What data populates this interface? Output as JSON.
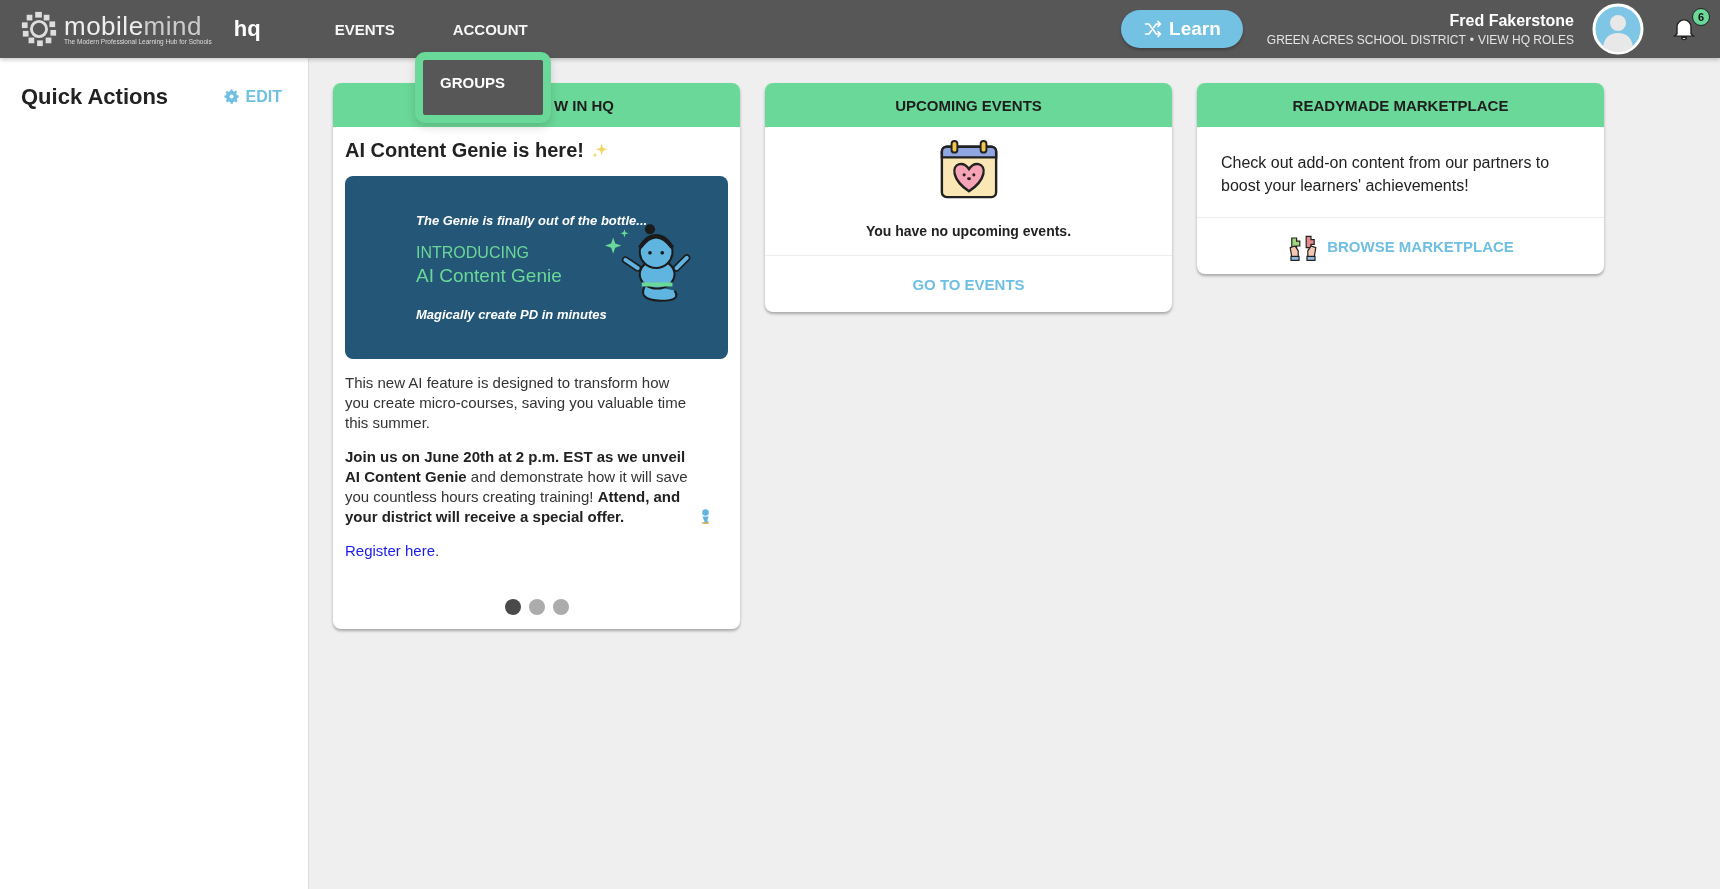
{
  "header": {
    "logo": {
      "first": "mobile",
      "second": "mind",
      "tagline": "The Modern Professional Learning Hub for Schools"
    },
    "product": "hq",
    "nav": [
      {
        "label": "EVENTS"
      },
      {
        "label": "ACCOUNT"
      }
    ],
    "learn_button": "Learn",
    "user": {
      "name": "Fred Fakerstone",
      "district": "GREEN ACRES SCHOOL DISTRICT",
      "separator": "•",
      "roles_link": "VIEW HQ ROLES"
    },
    "notifications": "6"
  },
  "dropdown": {
    "items": [
      "GROUPS"
    ]
  },
  "sidebar": {
    "title": "Quick Actions",
    "edit": "EDIT"
  },
  "cards": [
    {
      "kind": "news",
      "header": "W IN HQ",
      "title": "AI Content Genie is here!",
      "banner": {
        "tagline": "The Genie is finally out of the bottle...",
        "kicker": "INTRODUCING",
        "title": "AI Content Genie",
        "subtitle": "Magically create PD in minutes"
      },
      "paragraphs": [
        "This new AI feature is designed to transform how you create micro-courses, saving you valuable time this summer.",
        "**Join us on June 20th at 2 p.m. EST as we unveil AI Content Genie** and demonstrate how it will save you countless hours creating training! **Attend, and your district will receive a special offer.**"
      ],
      "register": {
        "link": "Register here",
        "suffix": "."
      },
      "dots": [
        {
          "selected": true
        },
        {
          "selected": false
        },
        {
          "selected": false
        }
      ]
    },
    {
      "kind": "events",
      "header": "UPCOMING EVENTS",
      "message": "You have no upcoming events.",
      "action": "GO TO EVENTS"
    },
    {
      "kind": "marketplace",
      "header": "READYMADE MARKETPLACE",
      "text": "Check out add-on content from our partners to boost your learners' achievements!",
      "action": "BROWSE MARKETPLACE"
    }
  ]
}
